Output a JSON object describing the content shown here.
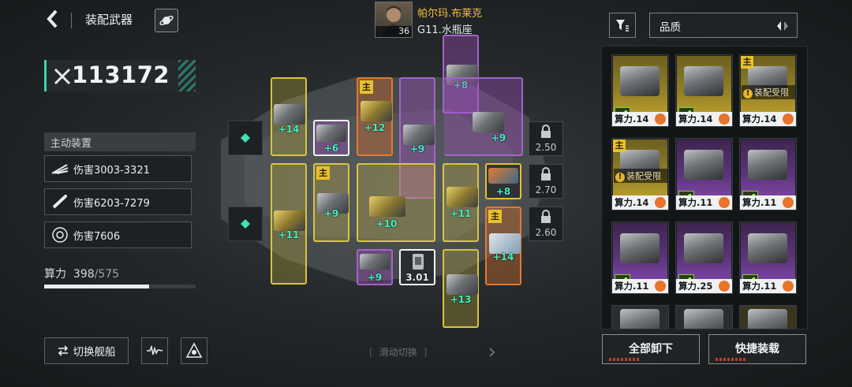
{
  "header": {
    "back_icon": "chevron-left-icon",
    "title": "装配武器",
    "planet_icon": "planet-icon"
  },
  "pilot": {
    "name": "帕尔玛.布莱克",
    "ship": "G11.水瓶座",
    "level": "36"
  },
  "power": {
    "value": "113172",
    "icon": "crossed-swords-icon"
  },
  "active_equipment": {
    "header": "主动装置",
    "rows": [
      {
        "icon": "wing-icon",
        "label": "伤害3003-3321"
      },
      {
        "icon": "missile-icon",
        "label": "伤害6203-7279"
      },
      {
        "icon": "target-icon",
        "label": "伤害7606"
      }
    ]
  },
  "compute": {
    "label": "算力",
    "used": "398",
    "max": "/575",
    "fraction": 0.692
  },
  "bottom_left": {
    "switch_label": "切换舰船",
    "switch_icon": "swap-icon",
    "wave_icon": "wave-icon",
    "fleet_icon": "fleet-icon"
  },
  "swipe_hint": "滑动切换",
  "slots": {
    "s1": "+14",
    "s2": "+6",
    "s3": "+12",
    "s4": "+8",
    "s5": "+9",
    "s6": "+9",
    "s7": "+11",
    "s8": "+9",
    "s9": "+10",
    "s10": "+11",
    "s11": "+8",
    "s12": "+14",
    "s13": "+9",
    "s14": "3.01",
    "s15": "+13"
  },
  "main_badge": "主",
  "locks": [
    "2.50",
    "2.70",
    "2.60"
  ],
  "right_panel": {
    "filter_icon": "filter-icon",
    "sort_label": "品质",
    "sort_icon": "sort-toggle-icon",
    "warn1": "装配受限",
    "warn2": "装配受限",
    "cards": [
      "算力.14",
      "算力.14",
      "算力.14",
      "算力.14",
      "算力.11",
      "算力.11",
      "算力.11",
      "算力.25",
      "算力.11"
    ],
    "unequip_all": "全部卸下",
    "quick_equip": "快捷装载"
  }
}
